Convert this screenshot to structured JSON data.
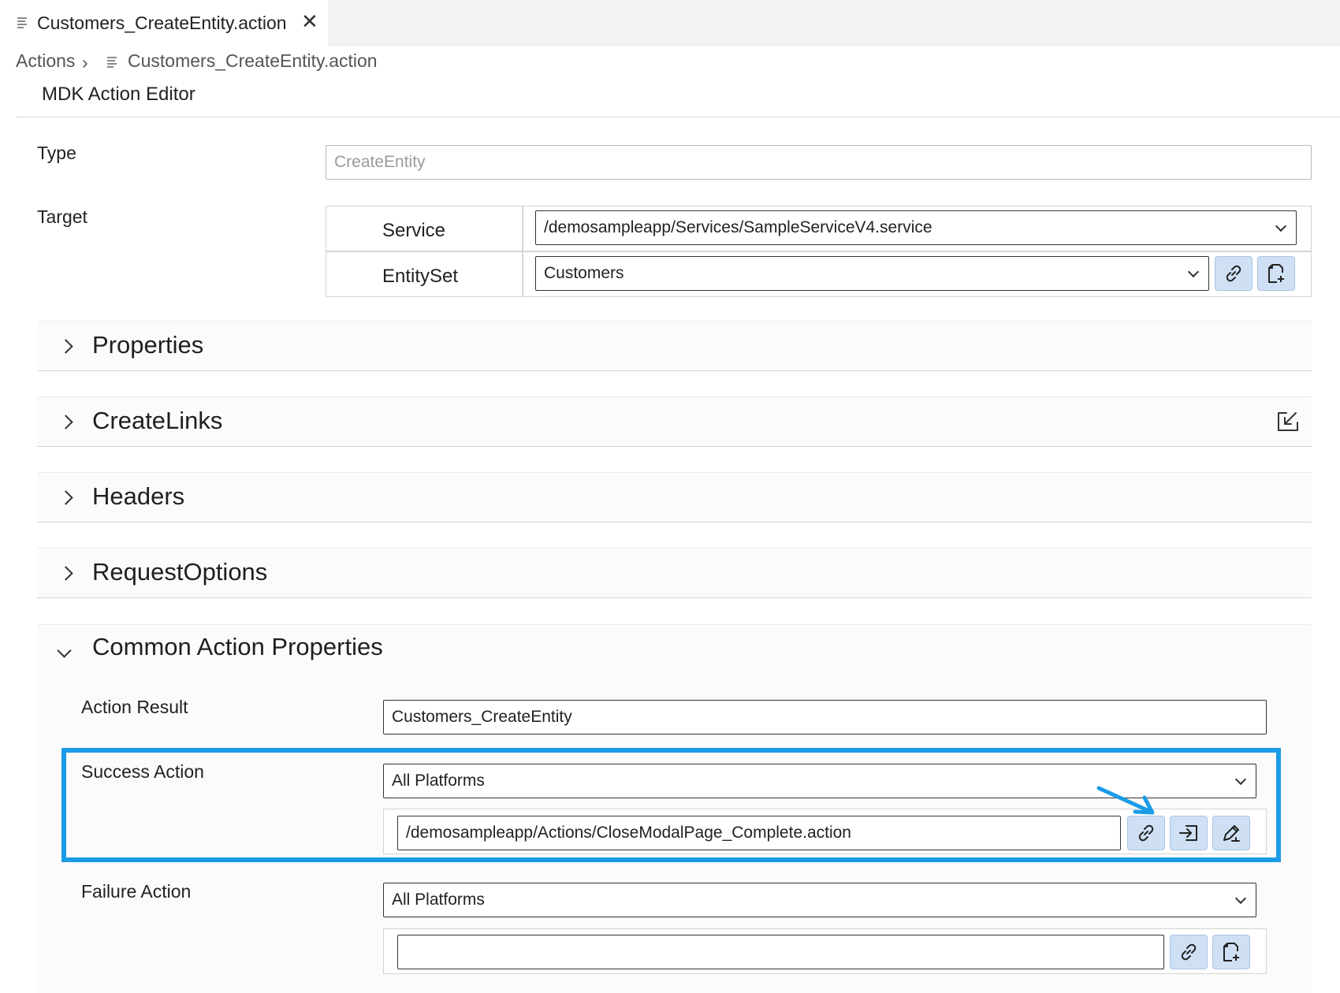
{
  "tab": {
    "label": "Customers_CreateEntity.action",
    "close_glyph": "✕"
  },
  "breadcrumb": {
    "root": "Actions",
    "separator": "›",
    "file": "Customers_CreateEntity.action"
  },
  "editor": {
    "title": "MDK Action Editor"
  },
  "type": {
    "label": "Type",
    "placeholder": "CreateEntity"
  },
  "target": {
    "label": "Target",
    "service_label": "Service",
    "service_value": "/demosampleapp/Services/SampleServiceV4.service",
    "entityset_label": "EntitySet",
    "entityset_value": "Customers"
  },
  "sections": {
    "properties": "Properties",
    "createlinks": "CreateLinks",
    "headers": "Headers",
    "requestoptions": "RequestOptions",
    "common": "Common Action Properties"
  },
  "common": {
    "action_result_label": "Action Result",
    "action_result_value": "Customers_CreateEntity",
    "success_label": "Success Action",
    "success_platform": "All Platforms",
    "success_value": "/demosampleapp/Actions/CloseModalPage_Complete.action",
    "failure_label": "Failure Action",
    "failure_platform": "All Platforms",
    "failure_value": ""
  },
  "colors": {
    "highlight": "#1b9be6",
    "button_bg": "#cfe0f5"
  },
  "icons": [
    "file-icon",
    "close-icon",
    "chevron-right-icon",
    "chevron-down-icon",
    "link-icon",
    "new-file-icon",
    "import-icon",
    "edit-icon",
    "export-icon",
    "arrow-annotation"
  ]
}
